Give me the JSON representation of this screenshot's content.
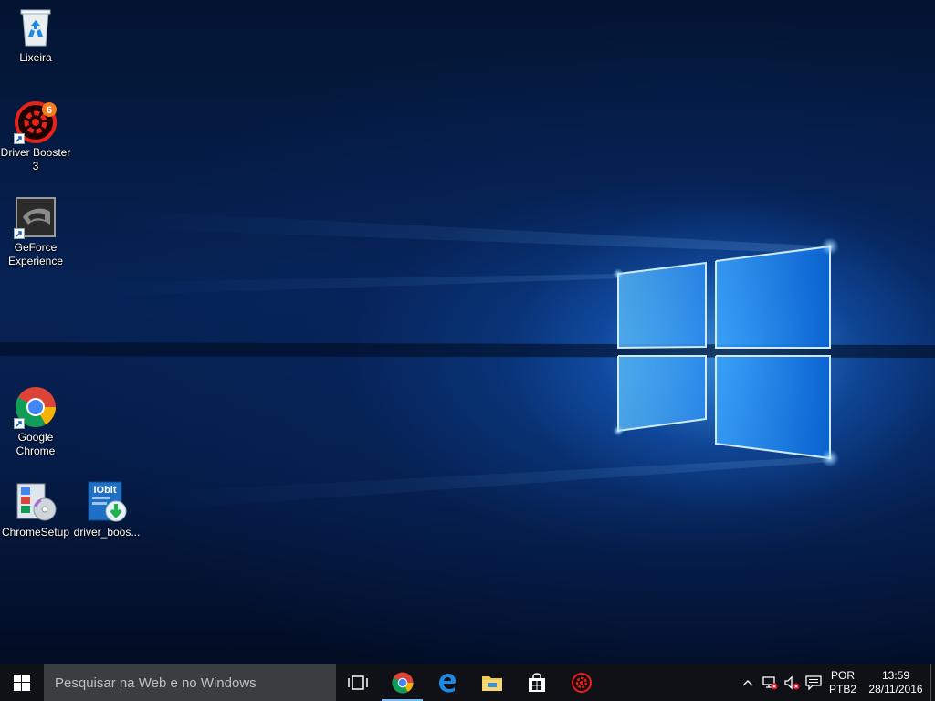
{
  "desktop": {
    "icons": [
      {
        "id": "recycle-bin",
        "label": "Lixeira"
      },
      {
        "id": "driver-booster",
        "label": "Driver Booster 3",
        "badge": "6"
      },
      {
        "id": "geforce-experience",
        "label": "GeForce Experience"
      },
      {
        "id": "google-chrome",
        "label": "Google Chrome"
      },
      {
        "id": "chrome-setup",
        "label": "ChromeSetup"
      },
      {
        "id": "driver-booster-setup",
        "label": "driver_boos...",
        "brand_text": "IObit"
      }
    ]
  },
  "taskbar": {
    "search_placeholder": "Pesquisar na Web e no Windows",
    "pinned": [
      {
        "name": "chrome",
        "icon": "chrome-icon",
        "active": true
      },
      {
        "name": "edge",
        "icon": "edge-icon",
        "active": false
      },
      {
        "name": "file-explorer",
        "icon": "folder-icon",
        "active": false
      },
      {
        "name": "store",
        "icon": "store-icon",
        "active": false
      },
      {
        "name": "driver-booster",
        "icon": "driver-booster-icon",
        "active": false
      }
    ],
    "tray": {
      "language_line1": "POR",
      "language_line2": "PTB2",
      "time": "13:59",
      "date": "28/11/2016"
    }
  },
  "colors": {
    "accent": "#1e90ff",
    "taskbar": "#0f1116",
    "search_box": "#3b3d40",
    "active_indicator": "#76b9ed"
  }
}
